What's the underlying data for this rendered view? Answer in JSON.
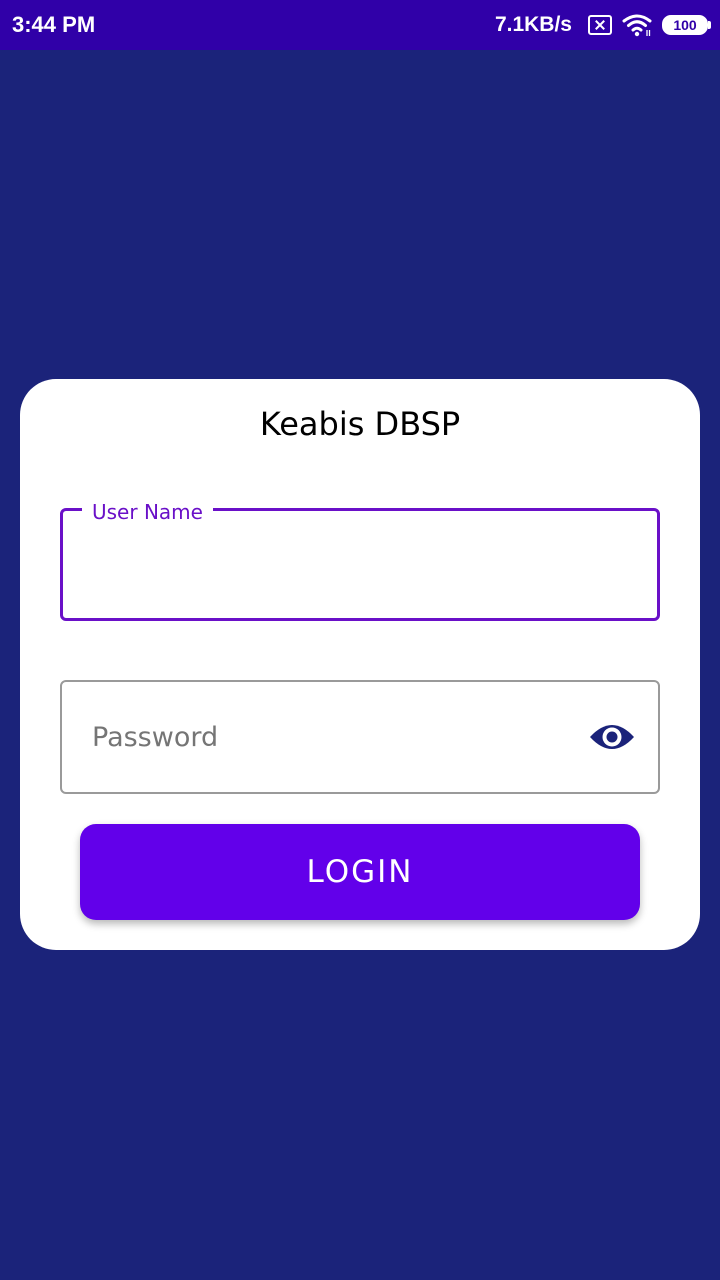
{
  "status_bar": {
    "time": "3:44 PM",
    "network_speed": "7.1KB/s",
    "battery_level": "100",
    "icons": [
      "sim-error-icon",
      "wifi-icon",
      "battery-icon"
    ]
  },
  "login_card": {
    "title": "Keabis DBSP",
    "username": {
      "label": "User Name",
      "value": ""
    },
    "password": {
      "placeholder": "Password",
      "value": "",
      "toggle_icon": "eye-icon"
    },
    "login_button_label": "LOGIN"
  },
  "colors": {
    "background": "#1b237a",
    "status_bar": "#3000a8",
    "accent": "#6200ea",
    "focus_outline": "#6a10c8",
    "eye_icon": "#1b237a"
  }
}
